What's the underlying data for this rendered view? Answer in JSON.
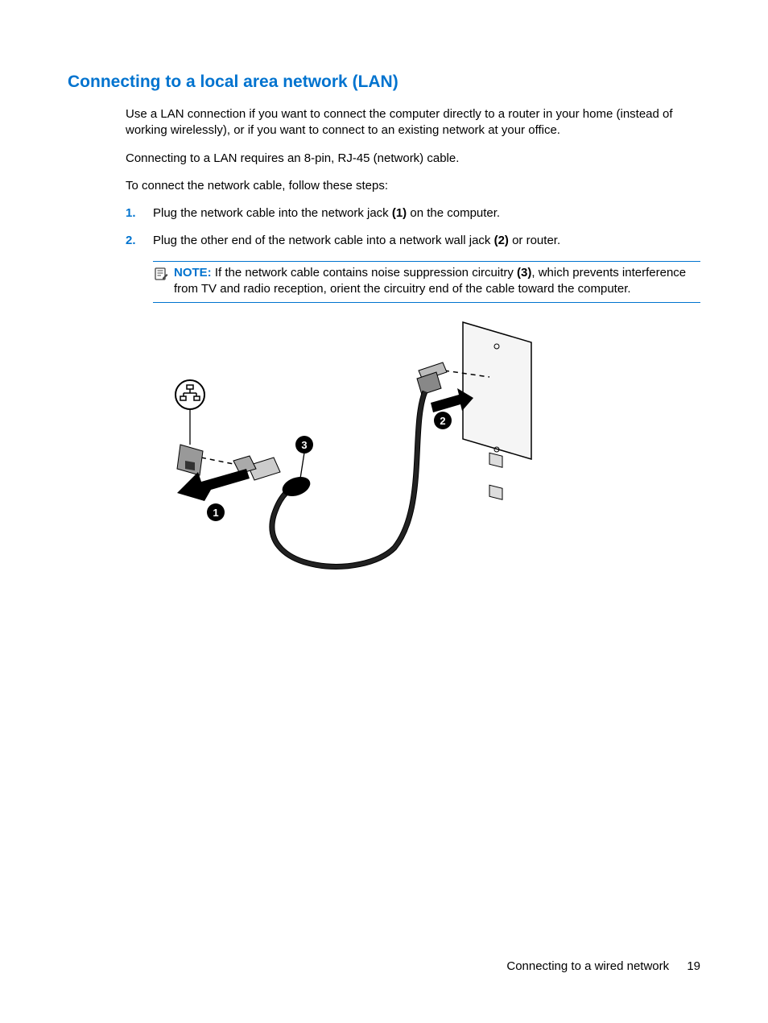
{
  "heading": "Connecting to a local area network (LAN)",
  "para1": "Use a LAN connection if you want to connect the computer directly to a router in your home (instead of working wirelessly), or if you want to connect to an existing network at your office.",
  "para2": "Connecting to a LAN requires an 8-pin, RJ-45 (network) cable.",
  "para3": "To connect the network cable, follow these steps:",
  "step1_pre": "Plug the network cable into the network jack ",
  "step1_bold": "(1)",
  "step1_post": " on the computer.",
  "step2_pre": "Plug the other end of the network cable into a network wall jack ",
  "step2_bold": "(2)",
  "step2_post": " or router.",
  "note_label": "NOTE:",
  "note_pre": "   If the network cable contains noise suppression circuitry ",
  "note_bold": "(3)",
  "note_post": ", which prevents interference from TV and radio reception, orient the circuitry end of the cable toward the computer.",
  "footer_section": "Connecting to a wired network",
  "footer_page": "19"
}
